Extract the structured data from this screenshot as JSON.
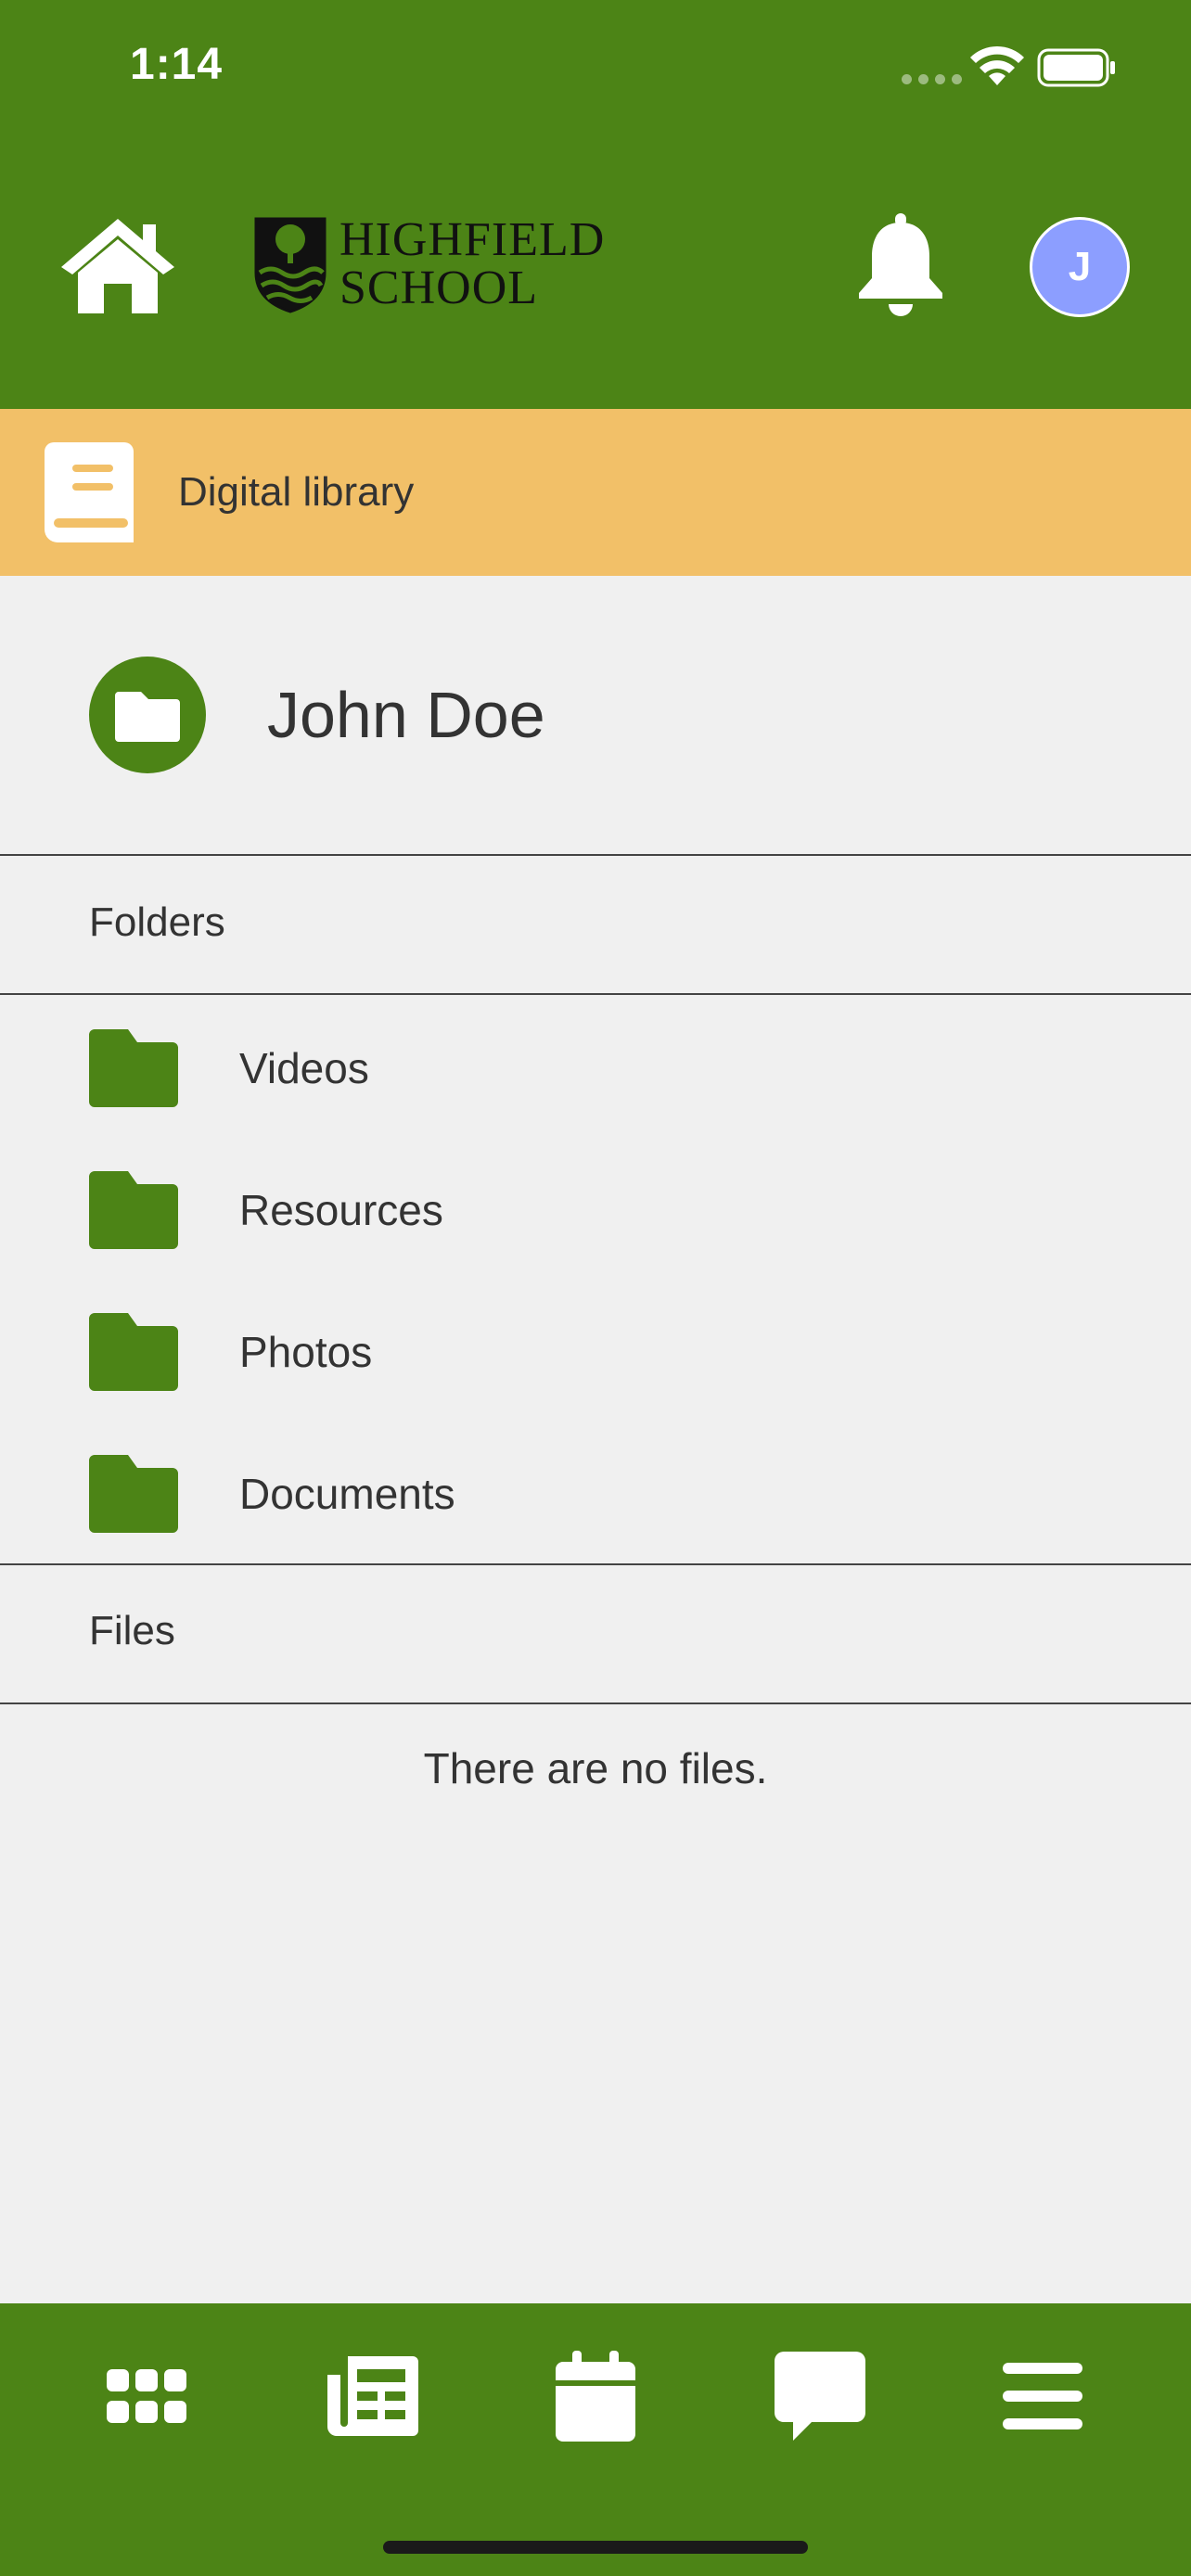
{
  "status_bar": {
    "time": "1:14"
  },
  "header": {
    "logo_line1": "HIGHFIELD",
    "logo_line2": "SCHOOL",
    "avatar_initial": "J"
  },
  "section": {
    "title": "Digital library"
  },
  "owner": {
    "name": "John Doe"
  },
  "folders": {
    "label": "Folders",
    "items": [
      {
        "label": "Videos"
      },
      {
        "label": "Resources"
      },
      {
        "label": "Photos"
      },
      {
        "label": "Documents"
      }
    ]
  },
  "files": {
    "label": "Files",
    "empty_message": "There are no files."
  },
  "tabbar": {
    "items": [
      {
        "icon": "apps-grid-icon"
      },
      {
        "icon": "newspaper-icon"
      },
      {
        "icon": "calendar-icon"
      },
      {
        "icon": "chat-icon"
      },
      {
        "icon": "menu-icon"
      }
    ]
  },
  "colors": {
    "brand_green": "#4c8416",
    "section_orange": "#f2c068",
    "avatar_blue": "#8c9eff",
    "background": "#f0f0f0"
  }
}
